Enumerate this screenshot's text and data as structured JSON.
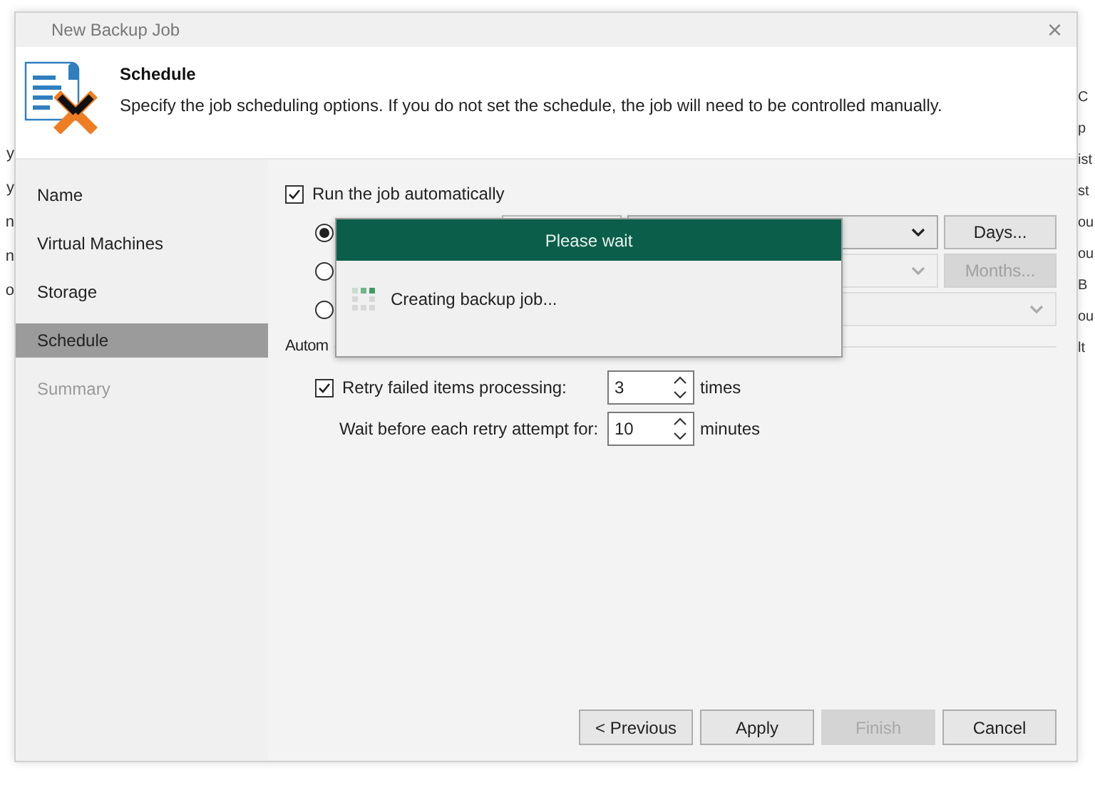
{
  "background": {
    "left_fragments": [
      "y",
      "y",
      "n",
      "n",
      "o"
    ],
    "right_fragments": [
      "C",
      "p",
      "ist",
      "st",
      "ou",
      "ou",
      "B",
      "ou",
      "lt"
    ]
  },
  "window": {
    "title": "New Backup Job",
    "close": "×"
  },
  "header": {
    "title": "Schedule",
    "description": "Specify the job scheduling options. If you do not set the schedule, the job will need to be controlled manually."
  },
  "sidebar": {
    "items": [
      {
        "label": "Name",
        "selected": false,
        "disabled": false
      },
      {
        "label": "Virtual Machines",
        "selected": false,
        "disabled": false
      },
      {
        "label": "Storage",
        "selected": false,
        "disabled": false
      },
      {
        "label": "Schedule",
        "selected": true,
        "disabled": false
      },
      {
        "label": "Summary",
        "selected": false,
        "disabled": true
      }
    ]
  },
  "schedule": {
    "run_automatically": {
      "label": "Run the job automatically",
      "checked": true
    },
    "options": [
      {
        "selected": true,
        "disabled": false,
        "button": "Days...",
        "button_disabled": false,
        "has_field": true
      },
      {
        "selected": false,
        "disabled": true,
        "button": "Months...",
        "button_disabled": true,
        "has_field": false
      },
      {
        "selected": false,
        "disabled": true,
        "has_field": false
      }
    ],
    "retry_section_label": "Autom",
    "retry": {
      "label": "Retry failed items processing:",
      "checked": true,
      "value": "3",
      "unit": "times"
    },
    "wait": {
      "label": "Wait before each retry attempt for:",
      "value": "10",
      "unit": "minutes"
    }
  },
  "progress_dialog": {
    "title": "Please wait",
    "message": "Creating backup job..."
  },
  "buttons": [
    {
      "label": "< Previous",
      "disabled": false
    },
    {
      "label": "Apply",
      "disabled": false
    },
    {
      "label": "Finish",
      "disabled": true
    },
    {
      "label": "Cancel",
      "disabled": false
    }
  ]
}
